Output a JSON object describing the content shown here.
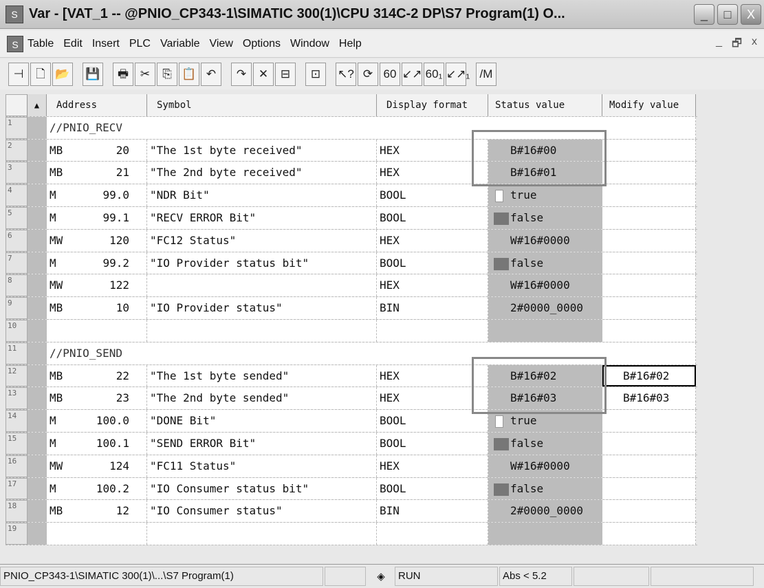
{
  "window": {
    "title": "Var - [VAT_1 -- @PNIO_CP343-1\\SIMATIC 300(1)\\CPU 314C-2 DP\\S7 Program(1)  O...",
    "minimize": "_",
    "maximize": "□",
    "close": "X"
  },
  "menu": [
    "Table",
    "Edit",
    "Insert",
    "PLC",
    "Variable",
    "View",
    "Options",
    "Window",
    "Help"
  ],
  "mdi": [
    "_",
    "🗗",
    "x"
  ],
  "toolbar": [
    "⊣",
    "🗋",
    "📂",
    "💾",
    "🖶",
    "✂",
    "⎘",
    "📋",
    "↶",
    "↷",
    "✕",
    "⊟",
    "⊡",
    "↖?",
    "⟳",
    "60",
    "↙↗",
    "60₁",
    "↙↗₁",
    "/M"
  ],
  "columns": {
    "address": "Address",
    "symbol": "Symbol",
    "format": "Display format",
    "status": "Status value",
    "modify": "Modify value"
  },
  "rows": [
    {
      "n": "1",
      "comment": "//PNIO_RECV"
    },
    {
      "n": "2",
      "op": "MB",
      "addr": "20",
      "sym": "\"The 1st byte received\"",
      "fmt": "HEX",
      "val": "B#16#00"
    },
    {
      "n": "3",
      "op": "MB",
      "addr": "21",
      "sym": "\"The 2nd byte received\"",
      "fmt": "HEX",
      "val": "B#16#01"
    },
    {
      "n": "4",
      "op": "M",
      "addr": "99.0",
      "sym": "\"NDR Bit\"",
      "fmt": "BOOL",
      "val": "true",
      "bool": "t"
    },
    {
      "n": "5",
      "op": "M",
      "addr": "99.1",
      "sym": "\"RECV ERROR Bit\"",
      "fmt": "BOOL",
      "val": "false",
      "bool": "f"
    },
    {
      "n": "6",
      "op": "MW",
      "addr": "120",
      "sym": "\"FC12 Status\"",
      "fmt": "HEX",
      "val": "W#16#0000"
    },
    {
      "n": "7",
      "op": "M",
      "addr": "99.2",
      "sym": "\"IO Provider status bit\"",
      "fmt": "BOOL",
      "val": "false",
      "bool": "f"
    },
    {
      "n": "8",
      "op": "MW",
      "addr": "122",
      "sym": "",
      "fmt": "HEX",
      "val": "W#16#0000"
    },
    {
      "n": "9",
      "op": "MB",
      "addr": "10",
      "sym": "\"IO Provider status\"",
      "fmt": "BIN",
      "val": "2#0000_0000"
    },
    {
      "n": "10"
    },
    {
      "n": "11",
      "comment": "//PNIO_SEND"
    },
    {
      "n": "12",
      "op": "MB",
      "addr": "22",
      "sym": "\"The 1st byte sended\"",
      "fmt": "HEX",
      "val": "B#16#02",
      "mod": "B#16#02",
      "sel": true
    },
    {
      "n": "13",
      "op": "MB",
      "addr": "23",
      "sym": "\"The 2nd byte sended\"",
      "fmt": "HEX",
      "val": "B#16#03",
      "mod": "B#16#03"
    },
    {
      "n": "14",
      "op": "M",
      "addr": "100.0",
      "sym": "\"DONE Bit\"",
      "fmt": "BOOL",
      "val": "true",
      "bool": "t"
    },
    {
      "n": "15",
      "op": "M",
      "addr": "100.1",
      "sym": "\"SEND ERROR Bit\"",
      "fmt": "BOOL",
      "val": "false",
      "bool": "f"
    },
    {
      "n": "16",
      "op": "MW",
      "addr": "124",
      "sym": "\"FC11 Status\"",
      "fmt": "HEX",
      "val": "W#16#0000"
    },
    {
      "n": "17",
      "op": "M",
      "addr": "100.2",
      "sym": "\"IO Consumer status bit\"",
      "fmt": "BOOL",
      "val": "false",
      "bool": "f"
    },
    {
      "n": "18",
      "op": "MB",
      "addr": "12",
      "sym": "\"IO Consumer status\"",
      "fmt": "BIN",
      "val": "2#0000_0000"
    },
    {
      "n": "19"
    }
  ],
  "statusbar": {
    "path": "PNIO_CP343-1\\SIMATIC 300(1)\\...\\S7 Program(1)",
    "mode_icon": "◈",
    "mode": "RUN",
    "abs": "Abs < 5.2"
  }
}
